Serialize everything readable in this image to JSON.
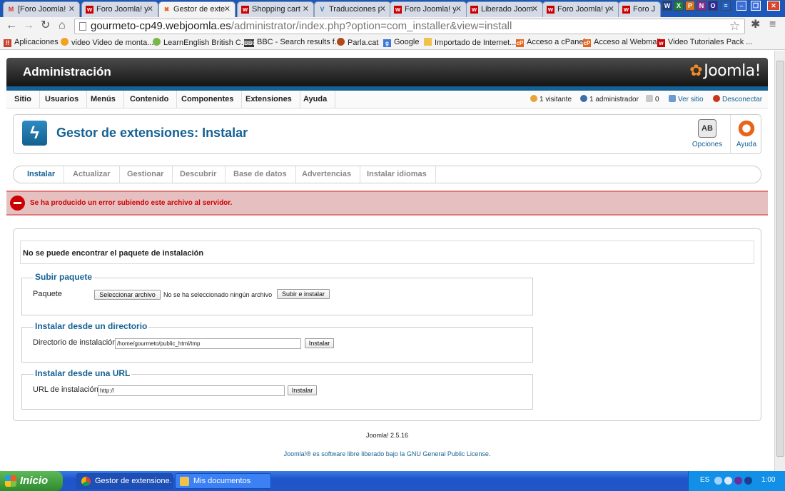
{
  "browser": {
    "tabs": [
      {
        "label": "[Foro Joomla!",
        "icon": "gmail-icon",
        "active": false
      },
      {
        "label": "Foro Joomla! y",
        "icon": "joomla-forum-icon",
        "active": false
      },
      {
        "label": "Gestor de exte",
        "icon": "joomla-icon",
        "active": true
      },
      {
        "label": "Shopping cart",
        "icon": "joomla-forum-icon",
        "active": false
      },
      {
        "label": "Traducciones p",
        "icon": "vm-icon",
        "active": false
      },
      {
        "label": "Foro Joomla! y",
        "icon": "joomla-forum-icon",
        "active": false
      },
      {
        "label": "Liberado Jooml",
        "icon": "joomla-forum-icon",
        "active": false
      },
      {
        "label": "Foro Joomla! y",
        "icon": "joomla-forum-icon",
        "active": false
      },
      {
        "label": "Foro J",
        "icon": "joomla-forum-icon",
        "active": false
      }
    ],
    "url_host": "gourmeto-cp49.webjoomla.es",
    "url_path": "/administrator/index.php?option=com_installer&view=install",
    "bookmarks": [
      {
        "label": "Aplicaciones",
        "icon": "apps-icon"
      },
      {
        "label": "video Video de monta...",
        "icon": "video-icon"
      },
      {
        "label": "LearnEnglish  British C...",
        "icon": "learnenglish-icon"
      },
      {
        "label": "BBC - Search results f...",
        "icon": "bbc-icon"
      },
      {
        "label": "Parla.cat",
        "icon": "parla-icon"
      },
      {
        "label": "Google",
        "icon": "google-icon"
      },
      {
        "label": "Importado de Internet...",
        "icon": "folder-icon"
      },
      {
        "label": "Acceso a cPanel",
        "icon": "cpanel-icon"
      },
      {
        "label": "Acceso al Webmail",
        "icon": "cpanel-icon"
      },
      {
        "label": "Video Tutoriales Pack ...",
        "icon": "joomla-forum-icon"
      }
    ]
  },
  "admin": {
    "header_title": "Administración",
    "logo_text": "Joomla!",
    "menu": [
      "Sitio",
      "Usuarios",
      "Menús",
      "Contenido",
      "Componentes",
      "Extensiones",
      "Ayuda"
    ],
    "status": {
      "visitors": "1 visitante",
      "admins": "1 administrador",
      "messages": "0",
      "view_site": "Ver sitio",
      "logout": "Desconectar"
    },
    "page_title": "Gestor de extensiones: Instalar",
    "toolbar": {
      "options": "Opciones",
      "help": "Ayuda",
      "options_icon_text": "AB"
    },
    "subtabs": [
      "Instalar",
      "Actualizar",
      "Gestionar",
      "Descubrir",
      "Base de datos",
      "Advertencias",
      "Instalar idiomas"
    ],
    "error_message": "Se ha producido un error subiendo este archivo al servidor.",
    "notice": "No se puede encontrar el paquete de instalación",
    "upload": {
      "legend": "Subir paquete",
      "label": "Paquete",
      "choose_button": "Seleccionar archivo",
      "no_file": "No se ha seleccionado ningún archivo",
      "submit_button": "Subir e instalar"
    },
    "directory": {
      "legend": "Instalar desde un directorio",
      "label": "Directorio de instalación",
      "value": "/home/gourmeto/public_html/tmp",
      "button": "Instalar"
    },
    "url": {
      "legend": "Instalar desde una URL",
      "label": "URL de instalación",
      "value": "http://",
      "button": "Instalar"
    },
    "footer": {
      "version": "Joomla! 2.5.16",
      "license_prefix": "Joomla!® es software libre liberado bajo la",
      "license_link": "GNU General Public License",
      "license_suffix": "."
    }
  },
  "taskbar": {
    "start": "Inicio",
    "tasks": [
      "Gestor de extensione...",
      "Mis documentos"
    ],
    "language": "ES",
    "clock": "1:00"
  },
  "colors": {
    "joomla_blue": "#146295",
    "error_red": "#cc0000",
    "error_bg": "#e6c0c0"
  }
}
